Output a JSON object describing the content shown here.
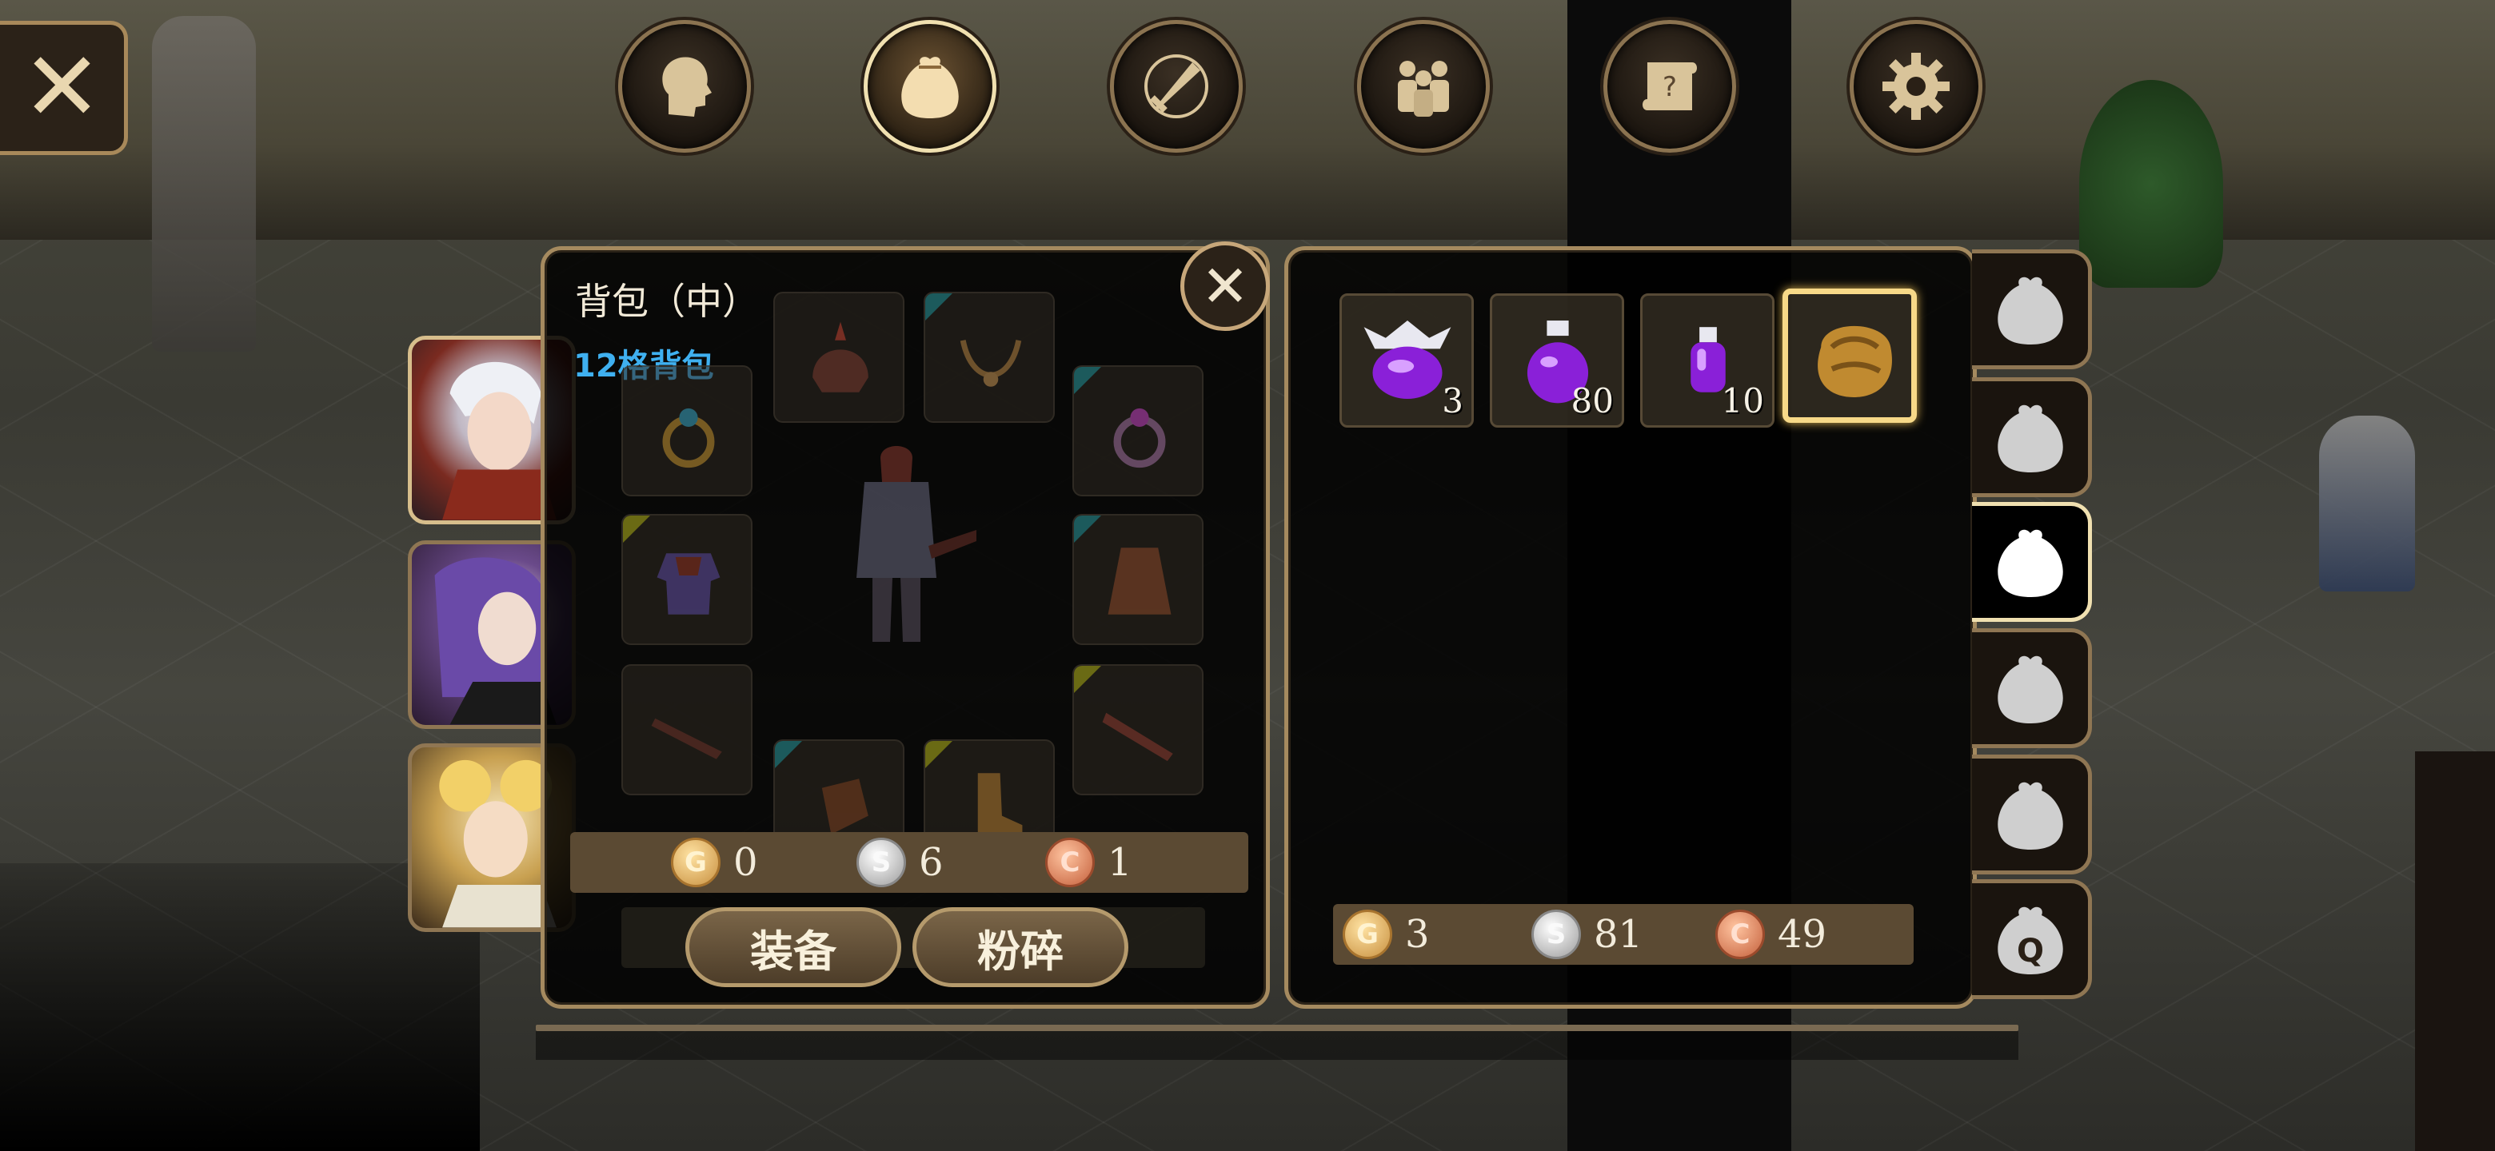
{
  "top_menu": {
    "items": [
      {
        "name": "character",
        "icon": "head-icon",
        "active": false
      },
      {
        "name": "bag",
        "icon": "bag-icon",
        "active": true
      },
      {
        "name": "skills",
        "icon": "sword-icon",
        "active": false
      },
      {
        "name": "party",
        "icon": "people-icon",
        "active": false
      },
      {
        "name": "quests",
        "icon": "scroll-icon",
        "active": false
      },
      {
        "name": "settings",
        "icon": "gear-icon",
        "active": false
      }
    ]
  },
  "close_main": {
    "label": "✕"
  },
  "equipment_panel": {
    "title": "背包（中）",
    "subtitle": "12格背包",
    "close_label": "✕",
    "currency": {
      "gold": {
        "symbol": "G",
        "value": "0"
      },
      "silver": {
        "symbol": "S",
        "value": "6"
      },
      "copper": {
        "symbol": "C",
        "value": "1"
      }
    },
    "buttons": {
      "equip": "装备",
      "smash": "粉碎"
    }
  },
  "inventory_panel": {
    "items": [
      {
        "name": "large-mana-potion",
        "icon": "potion-large-icon",
        "count": "3",
        "selected": false
      },
      {
        "name": "mana-potion",
        "icon": "potion-medium-icon",
        "count": "80",
        "selected": false
      },
      {
        "name": "small-mana-potion",
        "icon": "potion-small-icon",
        "count": "10",
        "selected": false
      },
      {
        "name": "leather-pouch",
        "icon": "pouch-icon",
        "count": "",
        "selected": true
      }
    ],
    "currency": {
      "gold": {
        "symbol": "G",
        "value": "3"
      },
      "silver": {
        "symbol": "S",
        "value": "81"
      },
      "copper": {
        "symbol": "C",
        "value": "49"
      }
    }
  },
  "bag_tabs": [
    {
      "name": "bag-tab-1",
      "label": "",
      "active": false
    },
    {
      "name": "bag-tab-2",
      "label": "",
      "active": false
    },
    {
      "name": "bag-tab-3",
      "label": "",
      "active": true
    },
    {
      "name": "bag-tab-4",
      "label": "",
      "active": false
    },
    {
      "name": "bag-tab-5",
      "label": "",
      "active": false
    },
    {
      "name": "bag-tab-quest",
      "label": "Q",
      "active": false
    }
  ],
  "party": [
    {
      "name": "white-hair-warrior",
      "active": true
    },
    {
      "name": "purple-hair-mage",
      "active": false
    },
    {
      "name": "blonde-cleric",
      "active": false
    }
  ],
  "colors": {
    "panel_border": "#a58a5f",
    "accent_blue": "#3fb0f0",
    "selected_border": "#f7d988",
    "currency_bar": "#5b4a33"
  }
}
